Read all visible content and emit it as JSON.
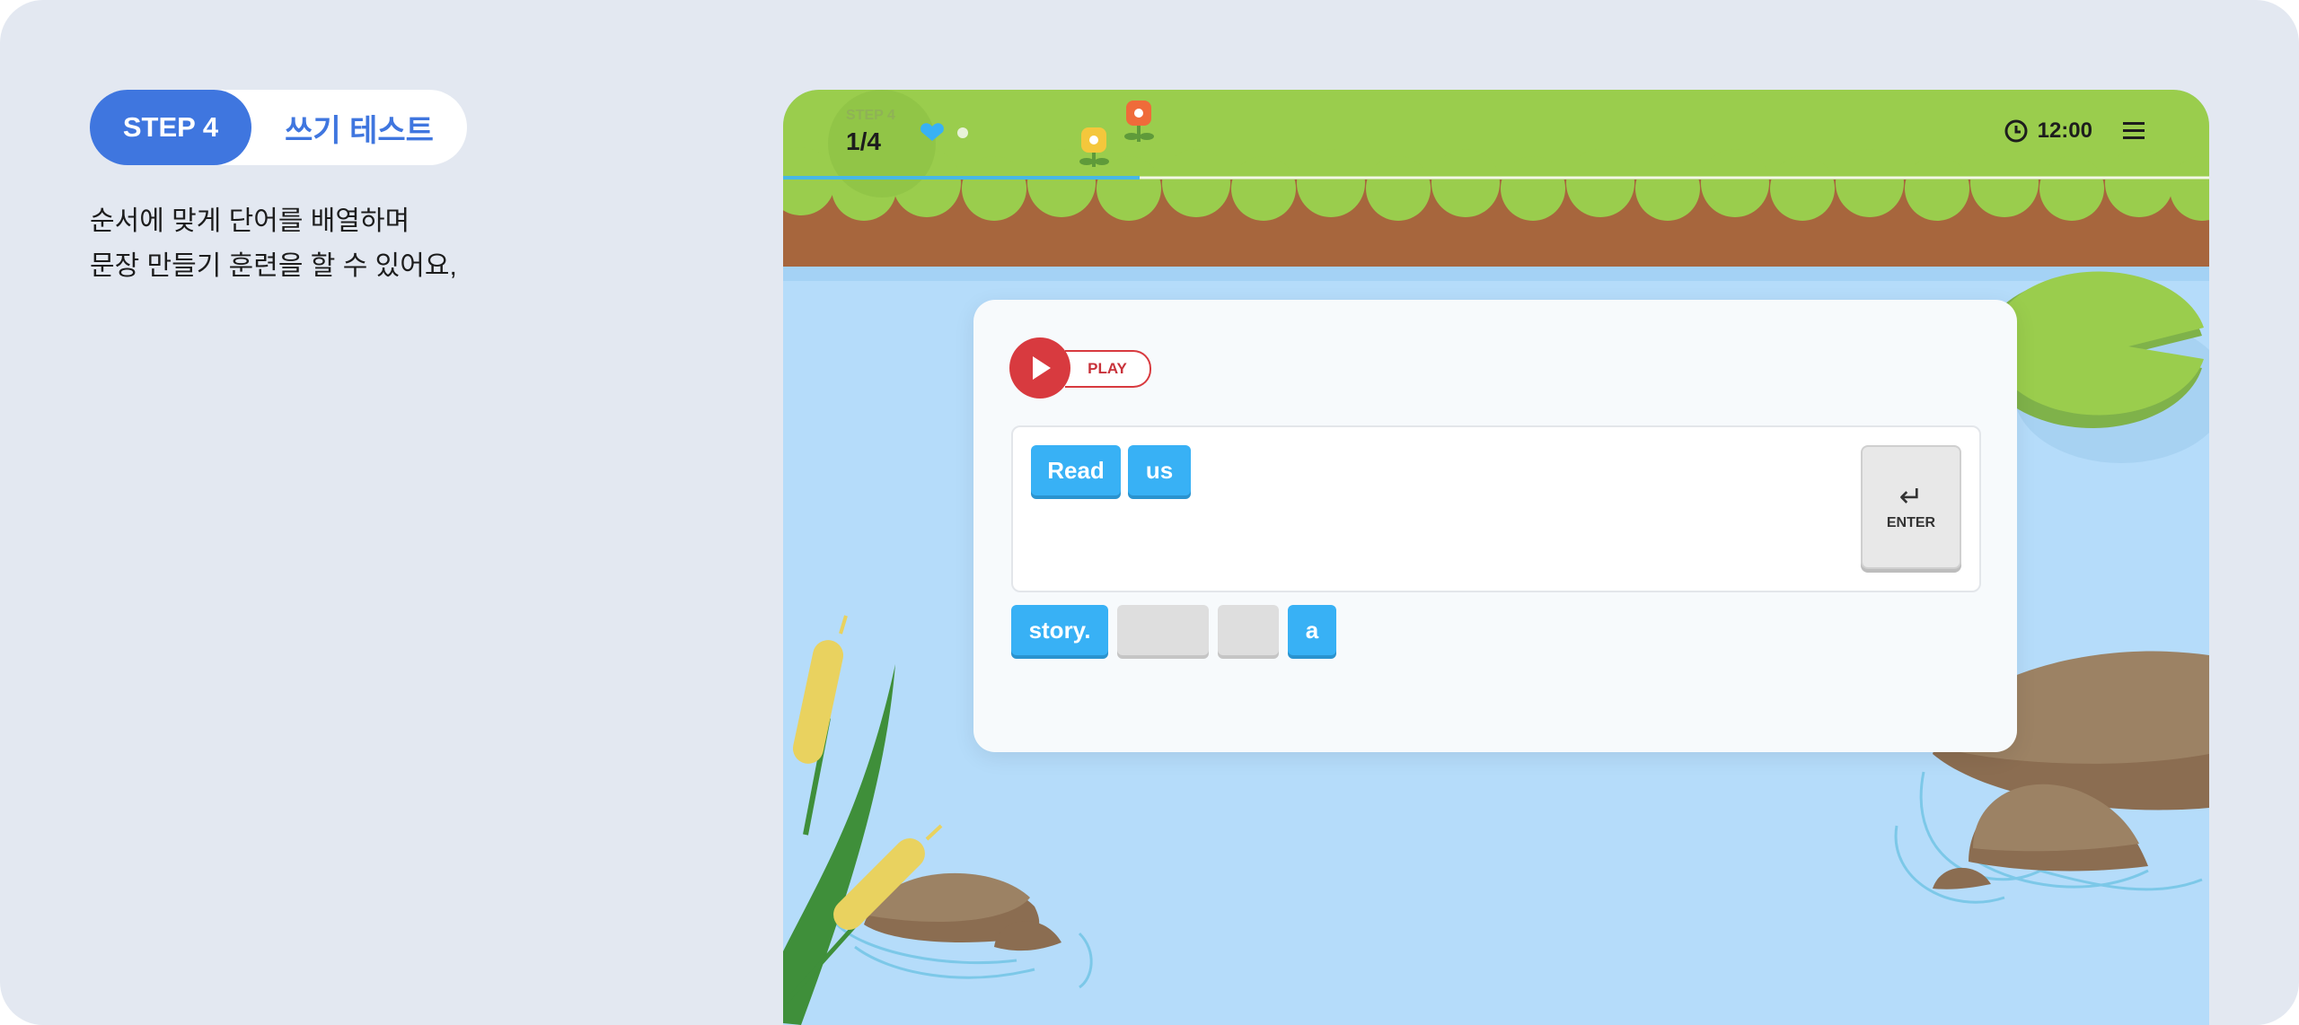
{
  "step_badge": {
    "step": "STEP 4",
    "title": "쓰기 테스트"
  },
  "description": [
    "순서에 맞게 단어를 배열하며",
    "문장 만들기 훈련을 할 수 있어요,"
  ],
  "game": {
    "header": {
      "step_label": "STEP 4",
      "progress": "1/4",
      "progress_fraction": 0.25,
      "time": "12:00",
      "clock_icon": "clock-icon",
      "menu_icon": "menu-icon"
    },
    "play_button": {
      "label": "PLAY",
      "icon": "play-icon"
    },
    "answer_words": [
      "Read",
      "us"
    ],
    "enter_key": {
      "icon": "enter-arrow-icon",
      "glyph": "↵",
      "label": "ENTER"
    },
    "word_bank": [
      {
        "text": "story.",
        "used": false
      },
      {
        "text": "",
        "used": true
      },
      {
        "text": "",
        "used": true
      },
      {
        "text": "a",
        "used": false
      }
    ],
    "colors": {
      "accent": "#3f76df",
      "word_chip": "#38b1f5",
      "play": "#d83a3f",
      "grass": "#9acd4d",
      "soil": "#a7663d",
      "water": "#b5dcfa"
    }
  }
}
